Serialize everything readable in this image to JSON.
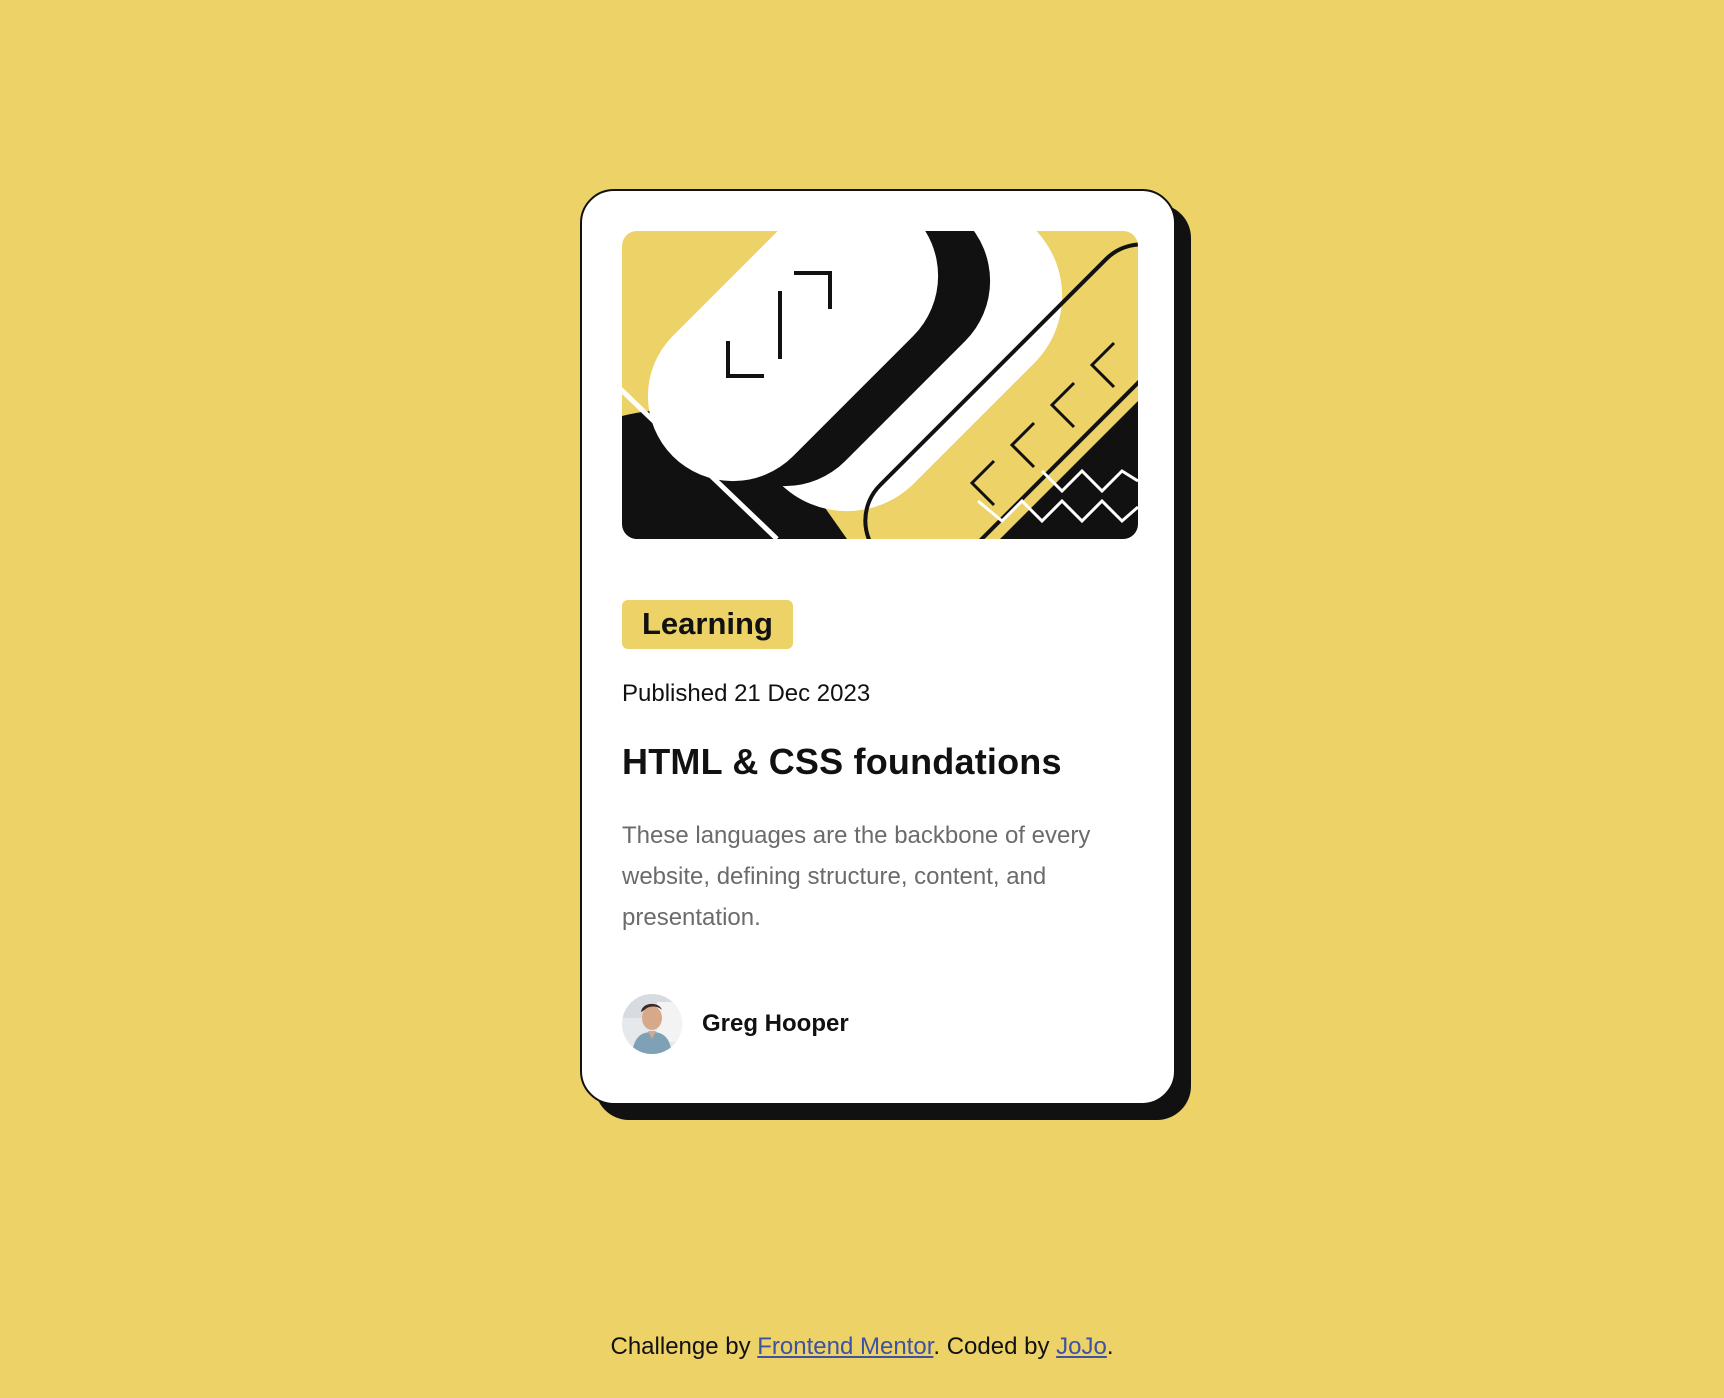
{
  "colors": {
    "background": "#ecd267",
    "card": "#ffffff",
    "ink": "#111111",
    "muted_text": "#6b6b6b",
    "link": "#3e52a3"
  },
  "card": {
    "hero_image": "illustration-article",
    "tag": "Learning",
    "published": "Published 21 Dec 2023",
    "title": "HTML & CSS foundations",
    "description": "These languages are the backbone of every website, defining structure, content, and presentation.",
    "author": {
      "avatar": "image-avatar",
      "name": "Greg Hooper"
    }
  },
  "footer": {
    "prefix": "Challenge by ",
    "link1": "Frontend Mentor",
    "middle": ". Coded by ",
    "link2": "JoJo",
    "suffix": "."
  }
}
